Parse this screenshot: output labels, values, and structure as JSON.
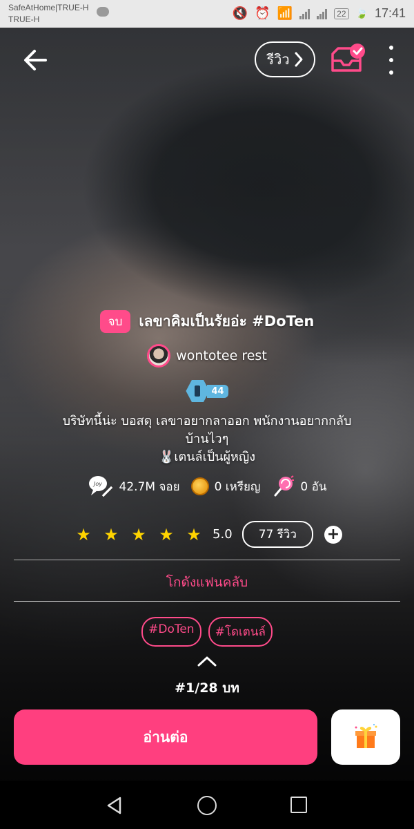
{
  "status_bar": {
    "carrier_line1": "SafeAtHome|TRUE-H",
    "carrier_line2": "TRUE-H",
    "battery": "22",
    "time": "17:41"
  },
  "header": {
    "review_label": "รีวิว"
  },
  "story": {
    "status_badge": "จบ",
    "title": "เลขาคิมเป็นรัยอ่ะ #DoTen",
    "author": "wontotee rest",
    "author_level": "44",
    "description_line1": "บริษัทนี้น่ะ บอสดุ เลขาอยากลาออก พนักงานอยากกลับ",
    "description_line2": "บ้านไวๆ",
    "description_line3": "🐰เตนล์เป็นผู้หญิง"
  },
  "stats": {
    "reads": "42.7M จอย",
    "coins": "0 เหรียญ",
    "candies": "0 อัน"
  },
  "rating": {
    "score": "5.0",
    "reviews": "77 รีวิว"
  },
  "fanclub_label": "โกดังแฟนคลับ",
  "tags": [
    "#DoTen",
    "#โดเตนล์"
  ],
  "chapter": "#1/28 บท",
  "actions": {
    "read_label": "อ่านต่อ"
  }
}
